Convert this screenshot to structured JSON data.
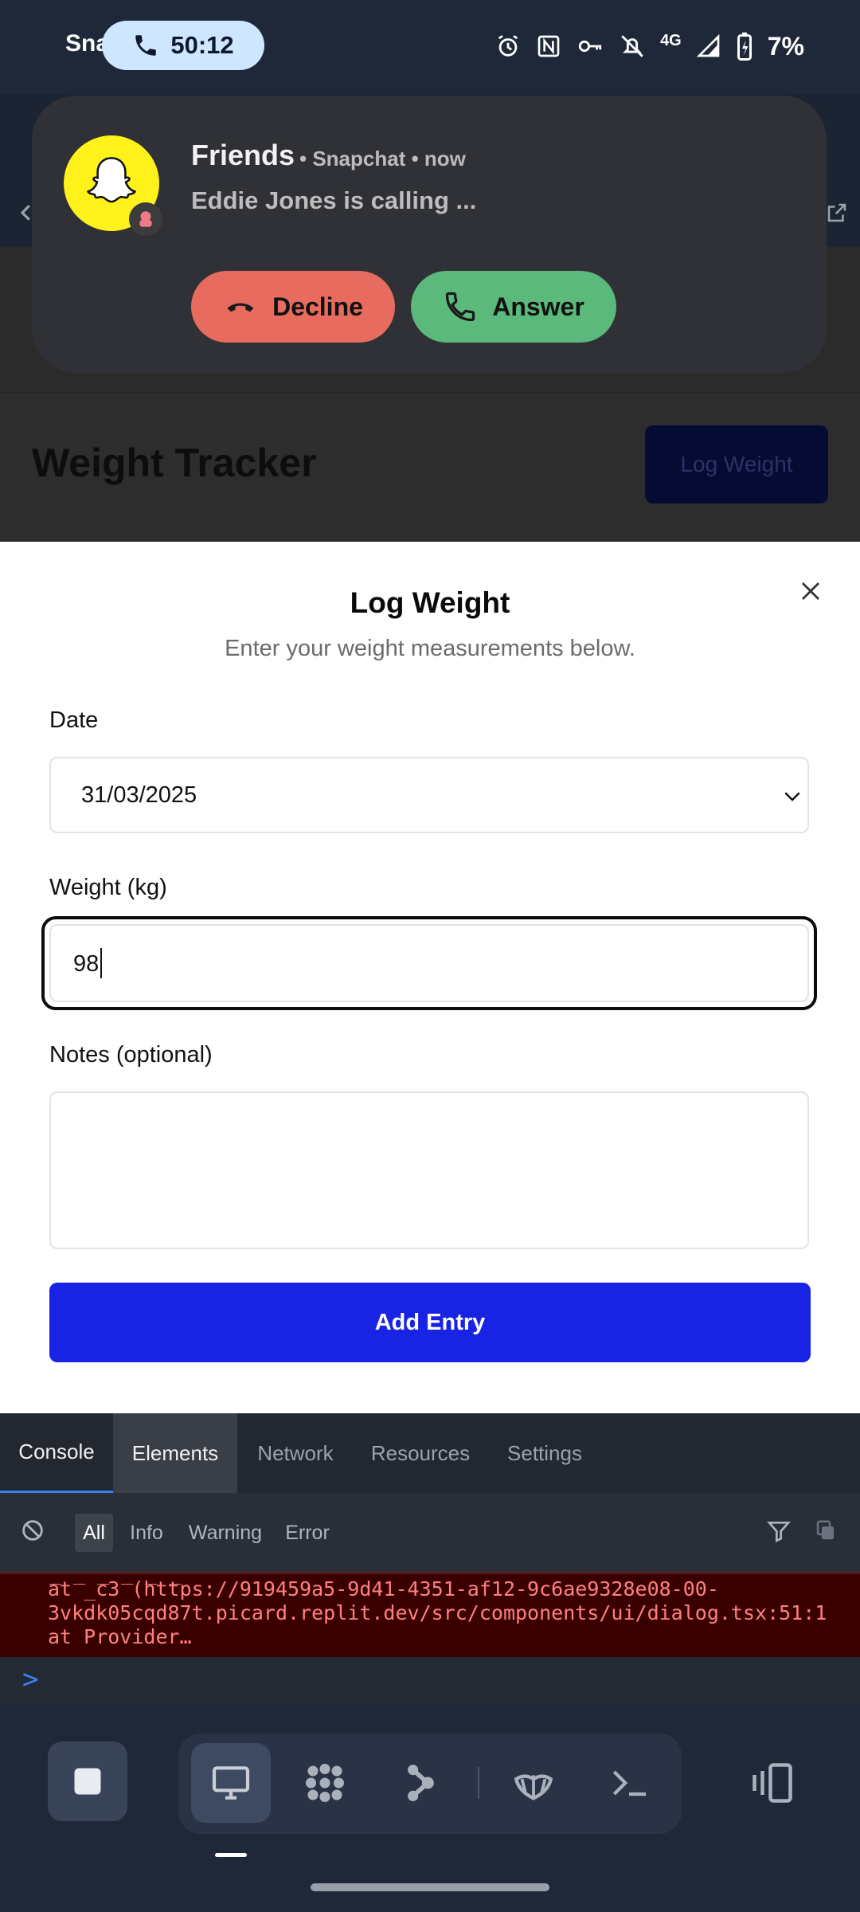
{
  "status_bar": {
    "app_name": "Sna",
    "call_timer": "50:12",
    "network": "4G",
    "battery": "7%",
    "icons": [
      "alarm-icon",
      "nfc-icon",
      "vpn-key-icon",
      "do-not-disturb-icon",
      "signal-icon",
      "battery-charging-icon"
    ]
  },
  "notification": {
    "title": "Friends",
    "meta": "• Snapchat • now",
    "body": "Eddie Jones is calling ...",
    "decline_label": "Decline",
    "answer_label": "Answer",
    "colors": {
      "decline": "#e86b5f",
      "answer": "#5bb97b",
      "avatar": "#fff21a"
    }
  },
  "app": {
    "title": "Weight Tracker",
    "log_button": "Log Weight"
  },
  "dialog": {
    "title": "Log Weight",
    "subtitle": "Enter your weight measurements below.",
    "date_label": "Date",
    "date_value": "31/03/2025",
    "weight_label": "Weight (kg)",
    "weight_value": "98",
    "notes_label": "Notes (optional)",
    "notes_value": "",
    "submit_label": "Add Entry",
    "accent_color": "#1823e4"
  },
  "devtools": {
    "tabs": [
      "Console",
      "Elements",
      "Network",
      "Resources",
      "Settings"
    ],
    "active_tab": "Console",
    "levels": [
      "All",
      "Info",
      "Warning",
      "Error"
    ],
    "active_level": "All",
    "error_lines": [
      "    at _c3 (https://919459a5-9d41-4351-af12-9c6ae9328e08-00-",
      "3vkdk05cqd87t.picard.replit.dev/src/components/ui/dialog.tsx:51:1",
      "    at Provider…"
    ],
    "prompt": ">"
  },
  "toolbar": {
    "tools": [
      "stop-icon",
      "desktop-icon",
      "agents-icon",
      "share-icon",
      "shell-icon",
      "terminal-icon",
      "split-view-icon"
    ]
  }
}
